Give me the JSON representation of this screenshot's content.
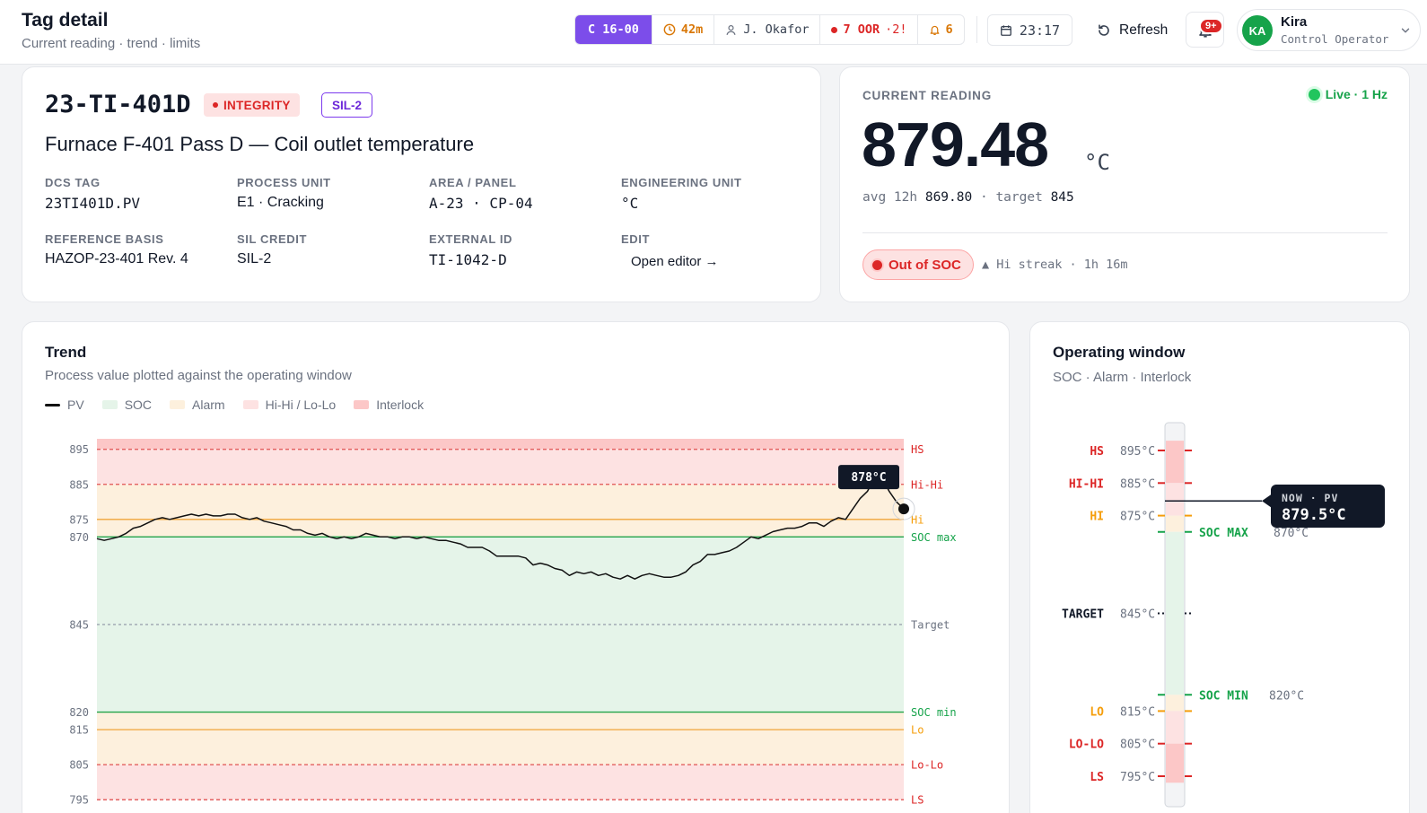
{
  "header": {
    "title": "Tag detail",
    "subtitle": "Current reading · trend · limits",
    "shift": "C 16-00",
    "timer": "42m",
    "operator": "J. Okafor",
    "oor": "7 OOR",
    "oor_delta": "·2!",
    "alarms": "6",
    "time": "23:17",
    "refresh_label": "Refresh",
    "notif_badge": "9+",
    "user": {
      "initials": "KA",
      "name": "Kira",
      "role": "Control Operator"
    }
  },
  "tag": {
    "id": "23-TI-401D",
    "integrity_badge": "INTEGRITY",
    "sil_badge": "SIL-2",
    "description": "Furnace F-401 Pass D — Coil outlet temperature",
    "fields": [
      {
        "label": "DCS TAG",
        "value": "23TI401D.PV",
        "mono": true
      },
      {
        "label": "PROCESS UNIT",
        "value": "E1 · Cracking",
        "mono": false
      },
      {
        "label": "AREA / PANEL",
        "value": "A-23 · CP-04",
        "mono": true
      },
      {
        "label": "ENGINEERING UNIT",
        "value": "°C",
        "mono": true
      },
      {
        "label": "REFERENCE BASIS",
        "value": "HAZOP-23-401 Rev. 4",
        "mono": false
      },
      {
        "label": "SIL CREDIT",
        "value": "SIL-2",
        "mono": false
      },
      {
        "label": "EXTERNAL ID",
        "value": "TI-1042-D",
        "mono": true
      },
      {
        "label": "EDIT",
        "value": "Open editor →",
        "mono": false
      }
    ]
  },
  "reading": {
    "label": "CURRENT READING",
    "live": "Live · 1 Hz",
    "value": "879.48",
    "unit": "°C",
    "avg_label": "avg 12h",
    "avg_value": "869.80",
    "target_label": "target",
    "target_value": "845",
    "status": "Out of SOC",
    "streak": "▲ Hi streak · 1h 16m"
  },
  "trend": {
    "title": "Trend",
    "subtitle": "Process value plotted against the operating window",
    "legend": [
      "PV",
      "SOC",
      "Alarm",
      "Hi-Hi / Lo-Lo",
      "Interlock"
    ],
    "tooltip": "878°C"
  },
  "chart_data": {
    "type": "line",
    "series": [
      {
        "name": "PV",
        "values": [
          869.5,
          869,
          869.5,
          870,
          871,
          872.5,
          873,
          874,
          875,
          875.5,
          875,
          875.5,
          876,
          876.5,
          876,
          876.5,
          876,
          876,
          876.5,
          876.5,
          875.5,
          875,
          875.5,
          874.5,
          874,
          873.5,
          873,
          872,
          872,
          871,
          870.5,
          871,
          870,
          869.5,
          870,
          869.5,
          870,
          871,
          870.5,
          870,
          870,
          869.5,
          870,
          870,
          869.5,
          870,
          869.5,
          869,
          869,
          868.5,
          868,
          867,
          867,
          867,
          866,
          864.5,
          864.5,
          864.5,
          864.5,
          864,
          862,
          862.5,
          862,
          861,
          860.5,
          859,
          860,
          859.5,
          860,
          859,
          859.5,
          858.5,
          858,
          859,
          858,
          859,
          859.5,
          859,
          858.5,
          858.5,
          859,
          860,
          862,
          863,
          865,
          865,
          865.5,
          866,
          867,
          868.5,
          870,
          869.5,
          870.5,
          871.5,
          872,
          872.5,
          872.5,
          873,
          874,
          874,
          873,
          874.5,
          875.5,
          875,
          878,
          881,
          883,
          887,
          887,
          883,
          880,
          878
        ]
      }
    ],
    "reference_lines": [
      {
        "label": "HS",
        "value": 895
      },
      {
        "label": "Hi-Hi",
        "value": 885
      },
      {
        "label": "Hi",
        "value": 875
      },
      {
        "label": "SOC max",
        "value": 870
      },
      {
        "label": "Target",
        "value": 845
      },
      {
        "label": "SOC min",
        "value": 820
      },
      {
        "label": "Lo",
        "value": 815
      },
      {
        "label": "Lo-Lo",
        "value": 805
      },
      {
        "label": "LS",
        "value": 795
      }
    ],
    "y_ticks": [
      895,
      885,
      875,
      870,
      845,
      820,
      815,
      805,
      795
    ],
    "ylim": [
      793,
      898
    ],
    "bands": [
      {
        "name": "Interlock",
        "from": 895,
        "to": 898,
        "color": "#fcc7c7"
      },
      {
        "name": "Hi-Hi / Lo-Lo",
        "from": 885,
        "to": 895,
        "color": "#fde2e2"
      },
      {
        "name": "Alarm",
        "from": 870,
        "to": 885,
        "color": "#fdf0dd"
      },
      {
        "name": "SOC",
        "from": 820,
        "to": 870,
        "color": "#e5f4e9"
      },
      {
        "name": "Alarm",
        "from": 805,
        "to": 820,
        "color": "#fdf0dd"
      },
      {
        "name": "Hi-Hi / Lo-Lo",
        "from": 795,
        "to": 805,
        "color": "#fde2e2"
      }
    ],
    "colors": {
      "pv": "#111111",
      "soc_line": "#22a34a",
      "alarm_line": "#f0a43a",
      "hihi_line": "#e05252",
      "target_line": "#9ca3af"
    }
  },
  "window": {
    "title": "Operating window",
    "subtitle": "SOC · Alarm · Interlock",
    "now_label": "NOW · PV",
    "now_value": "879.5°C",
    "now_pv": 879.5,
    "limits": [
      {
        "label": "HS",
        "value": "895°C",
        "v": 895,
        "side": "left",
        "color": "#dc2626"
      },
      {
        "label": "HI-HI",
        "value": "885°C",
        "v": 885,
        "side": "left",
        "color": "#dc2626"
      },
      {
        "label": "HI",
        "value": "875°C",
        "v": 875,
        "side": "left",
        "color": "#f59e0b"
      },
      {
        "label": "SOC MAX",
        "value": "870°C",
        "v": 870,
        "side": "right",
        "color": "#16a34a"
      },
      {
        "label": "TARGET",
        "value": "845°C",
        "v": 845,
        "side": "left",
        "color": "#111827"
      },
      {
        "label": "SOC MIN",
        "value": "820°C",
        "v": 820,
        "side": "right",
        "color": "#16a34a"
      },
      {
        "label": "LO",
        "value": "815°C",
        "v": 815,
        "side": "left",
        "color": "#f59e0b"
      },
      {
        "label": "LO-LO",
        "value": "805°C",
        "v": 805,
        "side": "left",
        "color": "#dc2626"
      },
      {
        "label": "LS",
        "value": "795°C",
        "v": 795,
        "side": "left",
        "color": "#dc2626"
      }
    ]
  }
}
